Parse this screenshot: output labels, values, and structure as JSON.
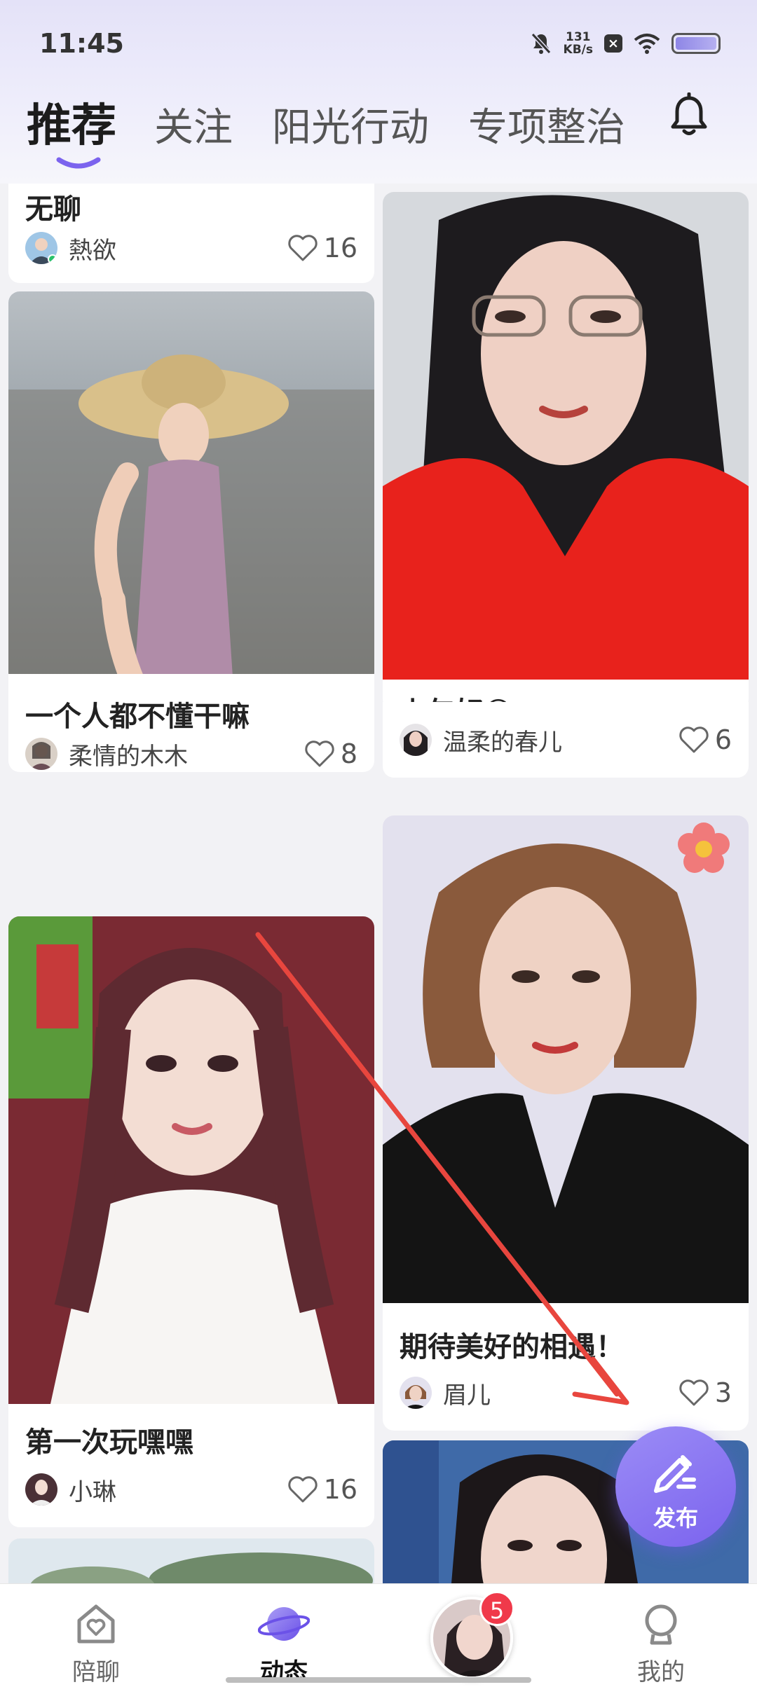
{
  "status_bar": {
    "time": "11:45",
    "net_speed_value": "131",
    "net_speed_unit": "KB/s",
    "icons": [
      "bell-muted-icon",
      "app-notice-icon",
      "wifi-icon",
      "battery-icon"
    ]
  },
  "header": {
    "tabs": [
      {
        "label": "推荐",
        "active": true
      },
      {
        "label": "关注",
        "active": false
      },
      {
        "label": "阳光行动",
        "active": false
      },
      {
        "label": "专项整治",
        "active": false
      }
    ],
    "accent_color": "#7b63ee"
  },
  "feed": {
    "left": [
      {
        "title": "无聊",
        "author": "熱欲",
        "likes": "16",
        "online": true
      },
      {
        "title": "一个人都不懂干嘛",
        "author": "柔情的木木",
        "likes": "8"
      },
      {
        "title": "第一次玩嘿嘿",
        "author": "小琳",
        "likes": "16"
      }
    ],
    "right": [
      {
        "title": "上午好😄",
        "author": "温柔的春儿",
        "likes": "6"
      },
      {
        "title": "期待美好的相遇！",
        "author": "眉儿",
        "likes": "3"
      }
    ]
  },
  "fab": {
    "label": "发布",
    "icon": "pencil-icon"
  },
  "bottom_nav": {
    "items": [
      {
        "label": "陪聊",
        "icon": "heart-house-icon"
      },
      {
        "label": "动态",
        "icon": "planet-icon",
        "active": true
      },
      {
        "label": "",
        "icon": "avatar",
        "badge": "5"
      },
      {
        "label": "我的",
        "icon": "profile-icon"
      }
    ]
  }
}
